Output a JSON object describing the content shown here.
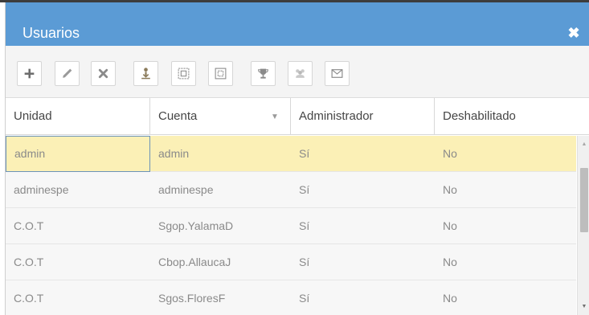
{
  "dialog": {
    "title": "Usuarios",
    "close_symbol": "✖"
  },
  "toolbar": {
    "buttons": [
      {
        "icon": "plus-icon",
        "enabled": true
      },
      {
        "icon": "pencil-icon",
        "enabled": true
      },
      {
        "icon": "delete-x-icon",
        "enabled": true
      },
      {
        "icon": "user-download-icon",
        "enabled": true
      },
      {
        "icon": "expand-grid-icon",
        "enabled": true
      },
      {
        "icon": "collapse-grid-icon",
        "enabled": true
      },
      {
        "icon": "trophy-icon",
        "enabled": true
      },
      {
        "icon": "users-group-icon",
        "enabled": false
      },
      {
        "icon": "envelope-icon",
        "enabled": true
      }
    ]
  },
  "table": {
    "columns": [
      "Unidad",
      "Cuenta",
      "Administrador",
      "Deshabilitado"
    ],
    "sort_symbol": "▼",
    "rows": [
      {
        "unidad": "admin",
        "cuenta": "admin",
        "administrador": "Sí",
        "deshabilitado": "No",
        "selected": true
      },
      {
        "unidad": "adminespe",
        "cuenta": "adminespe",
        "administrador": "Sí",
        "deshabilitado": "No",
        "selected": false
      },
      {
        "unidad": "C.O.T",
        "cuenta": "Sgop.YalamaD",
        "administrador": "Sí",
        "deshabilitado": "No",
        "selected": false
      },
      {
        "unidad": "C.O.T",
        "cuenta": "Cbop.AllaucaJ",
        "administrador": "Sí",
        "deshabilitado": "No",
        "selected": false
      },
      {
        "unidad": "C.O.T",
        "cuenta": "Sgos.FloresF",
        "administrador": "Sí",
        "deshabilitado": "No",
        "selected": false
      }
    ]
  },
  "scrollbar": {
    "up_symbol": "▲",
    "down_symbol": "▼"
  },
  "colors": {
    "titlebar": "#5b9bd5",
    "selected_row": "#fbf0b6",
    "row": "#f7f7f7",
    "toolbar": "#f4f4f4"
  }
}
